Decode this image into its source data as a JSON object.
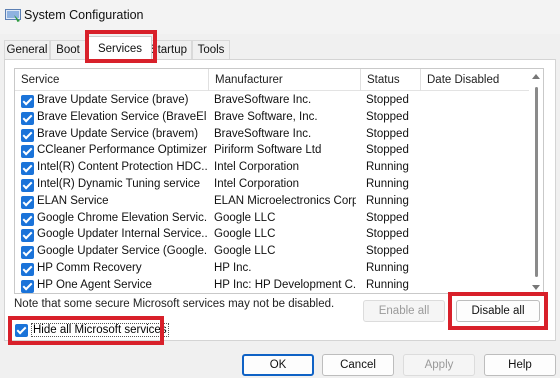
{
  "window": {
    "title": "System Configuration"
  },
  "tabs": [
    {
      "label": "General"
    },
    {
      "label": "Boot"
    },
    {
      "label": "Services"
    },
    {
      "label": "Startup"
    },
    {
      "label": "Tools"
    }
  ],
  "columns": {
    "service": "Service",
    "manufacturer": "Manufacturer",
    "status": "Status",
    "date_disabled": "Date Disabled"
  },
  "services": [
    {
      "name": "Brave Update Service (brave)",
      "manufacturer": "BraveSoftware Inc.",
      "status": "Stopped"
    },
    {
      "name": "Brave Elevation Service (BraveEl...",
      "manufacturer": "Brave Software, Inc.",
      "status": "Stopped"
    },
    {
      "name": "Brave Update Service (bravem)",
      "manufacturer": "BraveSoftware Inc.",
      "status": "Stopped"
    },
    {
      "name": "CCleaner Performance Optimizer...",
      "manufacturer": "Piriform Software Ltd",
      "status": "Stopped"
    },
    {
      "name": "Intel(R) Content Protection HDC...",
      "manufacturer": "Intel Corporation",
      "status": "Running"
    },
    {
      "name": "Intel(R) Dynamic Tuning service",
      "manufacturer": "Intel Corporation",
      "status": "Running"
    },
    {
      "name": "ELAN Service",
      "manufacturer": "ELAN Microelectronics Corp.",
      "status": "Running"
    },
    {
      "name": "Google Chrome Elevation Servic...",
      "manufacturer": "Google LLC",
      "status": "Stopped"
    },
    {
      "name": "Google Updater Internal Service...",
      "manufacturer": "Google LLC",
      "status": "Stopped"
    },
    {
      "name": "Google Updater Service (Google...",
      "manufacturer": "Google LLC",
      "status": "Stopped"
    },
    {
      "name": "HP Comm Recovery",
      "manufacturer": "HP Inc.",
      "status": "Running"
    },
    {
      "name": "HP One Agent Service",
      "manufacturer": "HP Inc: HP Development C...",
      "status": "Running"
    }
  ],
  "note": "Note that some secure Microsoft services may not be disabled.",
  "buttons": {
    "enable_all": "Enable all",
    "disable_all": "Disable all",
    "ok": "OK",
    "cancel": "Cancel",
    "apply": "Apply",
    "help": "Help"
  },
  "hide_ms": {
    "label": "Hide all Microsoft services",
    "checked": true
  },
  "colors": {
    "accent": "#1a73d9",
    "highlight": "#d8202a"
  }
}
